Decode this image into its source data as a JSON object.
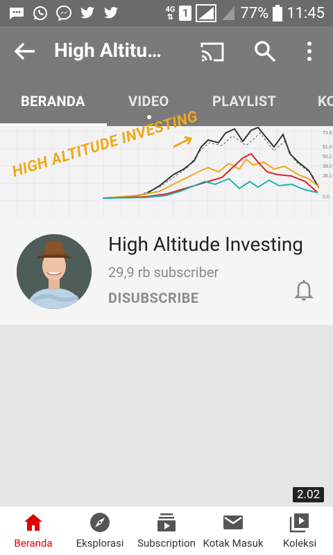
{
  "status_bar": {
    "battery": "77%",
    "time": "11:45",
    "network": "4G",
    "sim_slot": "1"
  },
  "app_bar": {
    "title": "High Altitu…"
  },
  "tabs": [
    {
      "label": "BERANDA",
      "active": true
    },
    {
      "label": "VIDEO",
      "active": false
    },
    {
      "label": "PLAYLIST",
      "active": false
    },
    {
      "label": "KO",
      "active": false
    }
  ],
  "banner": {
    "text": "HIGH ALTITUDE INVESTING",
    "axis_labels": [
      "73.6",
      "61.0",
      "50.2",
      "39.2",
      "28.1",
      "0.0"
    ]
  },
  "channel": {
    "name": "High Altitude Investing",
    "subscribers": "29,9 rb subscriber",
    "unsubscribe_label": "DISUBSCRIBE"
  },
  "video": {
    "duration": "2.02"
  },
  "bottom_nav": [
    {
      "label": "Beranda",
      "icon": "home-icon",
      "active": true
    },
    {
      "label": "Eksplorasi",
      "icon": "compass-icon",
      "active": false
    },
    {
      "label": "Subscription",
      "icon": "subscriptions-icon",
      "active": false
    },
    {
      "label": "Kotak Masuk",
      "icon": "inbox-icon",
      "active": false
    },
    {
      "label": "Koleksi",
      "icon": "library-icon",
      "active": false
    }
  ],
  "colors": {
    "active_red": "#e00000",
    "app_bar_gray": "#7a7a7a",
    "banner_gold": "#f0a818"
  }
}
